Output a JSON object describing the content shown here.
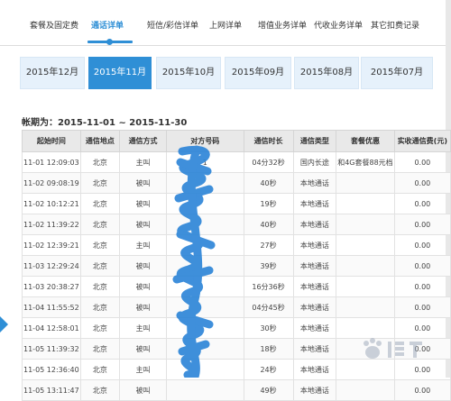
{
  "nav": {
    "items": [
      {
        "label": "套餐及固定费",
        "active": false
      },
      {
        "label": "通话详单",
        "active": true
      },
      {
        "label": "短信/彩信详单",
        "active": false
      },
      {
        "label": "上网详单",
        "active": false
      },
      {
        "label": "增值业务详单",
        "active": false
      },
      {
        "label": "代收业务详单",
        "active": false
      },
      {
        "label": "其它扣费记录",
        "active": false
      }
    ]
  },
  "months": [
    {
      "label": "2015年12月",
      "active": false
    },
    {
      "label": "2015年11月",
      "active": true
    },
    {
      "label": "2015年10月",
      "active": false
    },
    {
      "label": "2015年09月",
      "active": false
    },
    {
      "label": "2015年08月",
      "active": false
    },
    {
      "label": "2015年07月",
      "active": false
    }
  ],
  "period": "帐期为：2015-11-01 ~ 2015-11-30",
  "table": {
    "headers": [
      "起始时间",
      "通信地点",
      "通信方式",
      "对方号码",
      "通信时长",
      "通信类型",
      "套餐优惠",
      "实收通信费(元)"
    ],
    "rows": [
      [
        "11-01 12:09:03",
        "北京",
        "主叫",
        "1",
        "04分32秒",
        "国内长途",
        "和4G套餐88元档",
        "0.00"
      ],
      [
        "11-02 09:08:19",
        "北京",
        "被叫",
        "",
        "40秒",
        "本地通话",
        "",
        "0.00"
      ],
      [
        "11-02 10:12:21",
        "北京",
        "被叫",
        "",
        "19秒",
        "本地通话",
        "",
        "0.00"
      ],
      [
        "11-02 11:39:22",
        "北京",
        "被叫",
        "",
        "40秒",
        "本地通话",
        "",
        "0.00"
      ],
      [
        "11-02 12:39:21",
        "北京",
        "主叫",
        "",
        "27秒",
        "本地通话",
        "",
        "0.00"
      ],
      [
        "11-03 12:29:24",
        "北京",
        "被叫",
        "",
        "39秒",
        "本地通话",
        "",
        "0.00"
      ],
      [
        "11-03 20:38:27",
        "北京",
        "被叫",
        "",
        "16分36秒",
        "本地通话",
        "",
        "0.00"
      ],
      [
        "11-04 11:55:52",
        "北京",
        "被叫",
        "",
        "04分45秒",
        "本地通话",
        "",
        "0.00"
      ],
      [
        "11-04 12:58:01",
        "北京",
        "主叫",
        "",
        "30秒",
        "本地通话",
        "",
        "0.00"
      ],
      [
        "11-05 11:39:32",
        "北京",
        "被叫",
        "",
        "18秒",
        "本地通话",
        "",
        "0.00"
      ],
      [
        "11-05 12:36:40",
        "北京",
        "主叫",
        "",
        "24秒",
        "本地通话",
        "",
        "0.00"
      ],
      [
        "11-05 13:11:47",
        "北京",
        "被叫",
        "",
        "49秒",
        "本地通话",
        "",
        "0.00"
      ]
    ]
  },
  "colors": {
    "accent": "#2f8fd6",
    "tab_bg": "#e6f1fb",
    "header_bg": "#e9e9e9"
  }
}
